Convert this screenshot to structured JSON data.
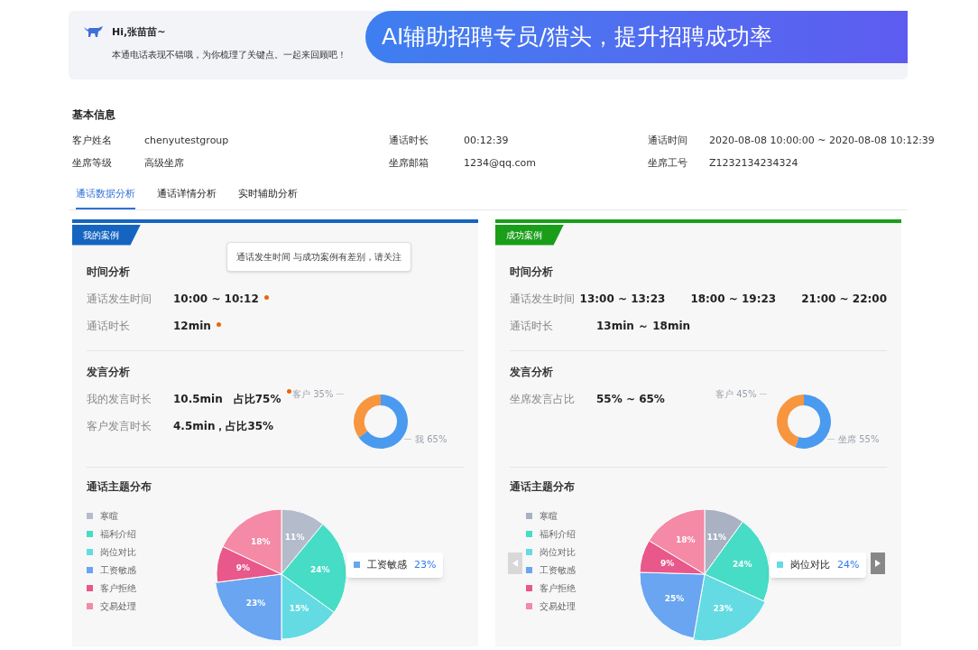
{
  "header": {
    "greeting": "Hi,张苗苗~",
    "message": "本通电话表现不错哦，为你梳理了关键点。一起来回顾吧！",
    "banner": "AI辅助招聘专员/猎头，提升招聘成功率"
  },
  "basic_info": {
    "title": "基本信息",
    "fields": [
      {
        "label": "客户姓名",
        "value": "chenyutestgroup"
      },
      {
        "label": "通话时长",
        "value": "00:12:39"
      },
      {
        "label": "通话时间",
        "value": "2020-08-08 10:00:00 ~ 2020-08-08 10:12:39"
      },
      {
        "label": "坐席等级",
        "value": "高级坐席"
      },
      {
        "label": "坐席邮箱",
        "value": "1234@qq.com"
      },
      {
        "label": "坐席工号",
        "value": "Z1232134234324"
      }
    ]
  },
  "tabs": [
    {
      "label": "通话数据分析",
      "selected": true
    },
    {
      "label": "通话详情分析",
      "selected": false
    },
    {
      "label": "实时辅助分析",
      "selected": false
    }
  ],
  "panels": [
    {
      "title": "我的案例",
      "color": "#1565c0",
      "time": {
        "title": "时间分析",
        "rows": [
          {
            "label": "通话发生时间",
            "values": [
              "10:00 ~ 10:12"
            ],
            "flagged": true
          },
          {
            "label": "通话时长",
            "values": [
              "12min"
            ],
            "flagged": true
          }
        ],
        "tooltip": "通话发生时间 与成功案例有差别，请关注"
      },
      "speech": {
        "title": "发言分析",
        "rows": [
          {
            "label": "我的发言时长",
            "values": [
              "10.5min　占比75%"
            ],
            "flagged": true
          },
          {
            "label": "客户发言时长",
            "values": [
              "4.5min，占比35%"
            ],
            "flagged": false
          }
        ],
        "donut": {
          "slices": [
            {
              "color": "#f7963f"
            },
            {
              "color": "#4a9af0"
            }
          ],
          "chart_data": {
            "type": "donut",
            "categories": [
              "客户",
              "我"
            ],
            "values": [
              35,
              65
            ],
            "value_labels": [
              "35%",
              "65%"
            ]
          }
        }
      },
      "topics": {
        "title": "通话主题分布",
        "slices": [
          {
            "color": "#b4bccb",
            "hovered": false
          },
          {
            "color": "#47dcc6",
            "hovered": false
          },
          {
            "color": "#64dbe3",
            "hovered": false
          },
          {
            "color": "#69a5f0",
            "hovered": true
          },
          {
            "color": "#e8588a",
            "hovered": false
          },
          {
            "color": "#f48aa5",
            "hovered": false
          }
        ],
        "chart_data": {
          "type": "pie",
          "categories": [
            "寒暄",
            "福利介绍",
            "岗位对比",
            "工资敏感",
            "客户拒绝",
            "交易处理"
          ],
          "values": [
            11,
            24,
            15,
            23,
            9,
            18
          ],
          "value_labels": [
            "11%",
            "24%",
            "15%",
            "23%",
            "9%",
            "18%"
          ]
        },
        "tooltip": {
          "label": "工资敏感",
          "value": "23%"
        }
      }
    },
    {
      "title": "成功案例",
      "color": "#1a9e1a",
      "time": {
        "title": "时间分析",
        "rows": [
          {
            "label": "通话发生时间",
            "values": [
              "13:00 ~ 13:23",
              "18:00 ~ 19:23",
              "21:00 ~ 22:00"
            ],
            "flagged": false
          },
          {
            "label": "通话时长",
            "values": [
              "13min ～ 18min"
            ],
            "flagged": false
          }
        ]
      },
      "speech": {
        "title": "发言分析",
        "rows": [
          {
            "label": "坐席发言占比",
            "values": [
              "55% ~ 65%"
            ],
            "flagged": false
          }
        ],
        "donut": {
          "slices": [
            {
              "color": "#f7963f"
            },
            {
              "color": "#4a9af0"
            }
          ],
          "chart_data": {
            "type": "donut",
            "categories": [
              "客户",
              "坐席"
            ],
            "values": [
              45,
              55
            ],
            "value_labels": [
              "45%",
              "55%"
            ]
          }
        }
      },
      "topics": {
        "title": "通话主题分布",
        "slices": [
          {
            "color": "#a9b1c2",
            "hovered": false
          },
          {
            "color": "#47dcc6",
            "hovered": false
          },
          {
            "color": "#64dbe3",
            "hovered": true
          },
          {
            "color": "#69a5f0",
            "hovered": false
          },
          {
            "color": "#e8588a",
            "hovered": false
          },
          {
            "color": "#f48aa5",
            "hovered": false
          }
        ],
        "chart_data": {
          "type": "pie",
          "categories": [
            "寒暄",
            "福利介绍",
            "岗位对比",
            "工资敏感",
            "客户拒绝",
            "交易处理"
          ],
          "values": [
            11,
            24,
            23,
            25,
            9,
            18
          ],
          "value_labels": [
            "11%",
            "24%",
            "23%",
            "25%",
            "9%",
            "18%"
          ]
        },
        "tooltip": {
          "label": "岗位对比",
          "value": "24%"
        },
        "nav": {
          "prev_disabled": true,
          "next_disabled": false
        }
      }
    }
  ]
}
